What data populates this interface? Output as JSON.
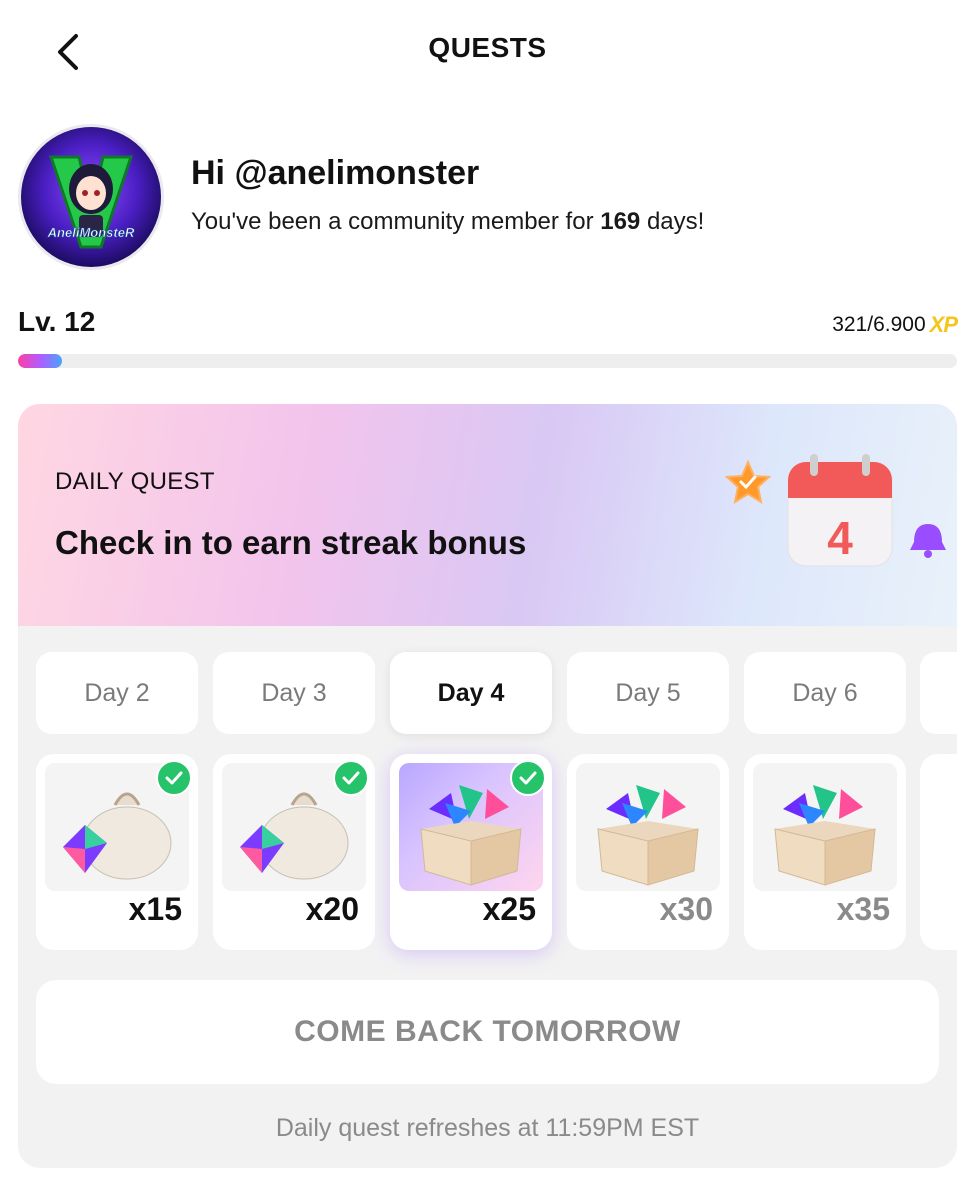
{
  "header": {
    "title": "QUESTS",
    "back_icon": "chevron-left-icon"
  },
  "profile": {
    "greeting": "Hi @anelimonster",
    "member_prefix": "You've been a community member for ",
    "member_days": "169",
    "member_suffix": " days!",
    "avatar_text": "AneliMonsteR"
  },
  "level": {
    "label": "Lv. 12",
    "xp_text": "321/6.900",
    "xp_badge": "XP",
    "progress_fraction": 0.0465
  },
  "quest": {
    "kicker": "DAILY QUEST",
    "title": "Check in to earn streak bonus",
    "calendar_number": "4",
    "days": [
      {
        "label": "Day 2",
        "qty": "x15",
        "claimed": true,
        "active": false,
        "reward": "bag"
      },
      {
        "label": "Day 3",
        "qty": "x20",
        "claimed": true,
        "active": false,
        "reward": "bag"
      },
      {
        "label": "Day 4",
        "qty": "x25",
        "claimed": true,
        "active": true,
        "reward": "box"
      },
      {
        "label": "Day 5",
        "qty": "x30",
        "claimed": false,
        "active": false,
        "reward": "box"
      },
      {
        "label": "Day 6",
        "qty": "x35",
        "claimed": false,
        "active": false,
        "reward": "box"
      }
    ],
    "button_label": "COME BACK TOMORROW",
    "refresh_note": "Daily quest refreshes at 11:59PM EST"
  },
  "colors": {
    "xp_gold": "#f5c518",
    "check_green": "#27c36a",
    "muted": "#8a8a8a"
  }
}
